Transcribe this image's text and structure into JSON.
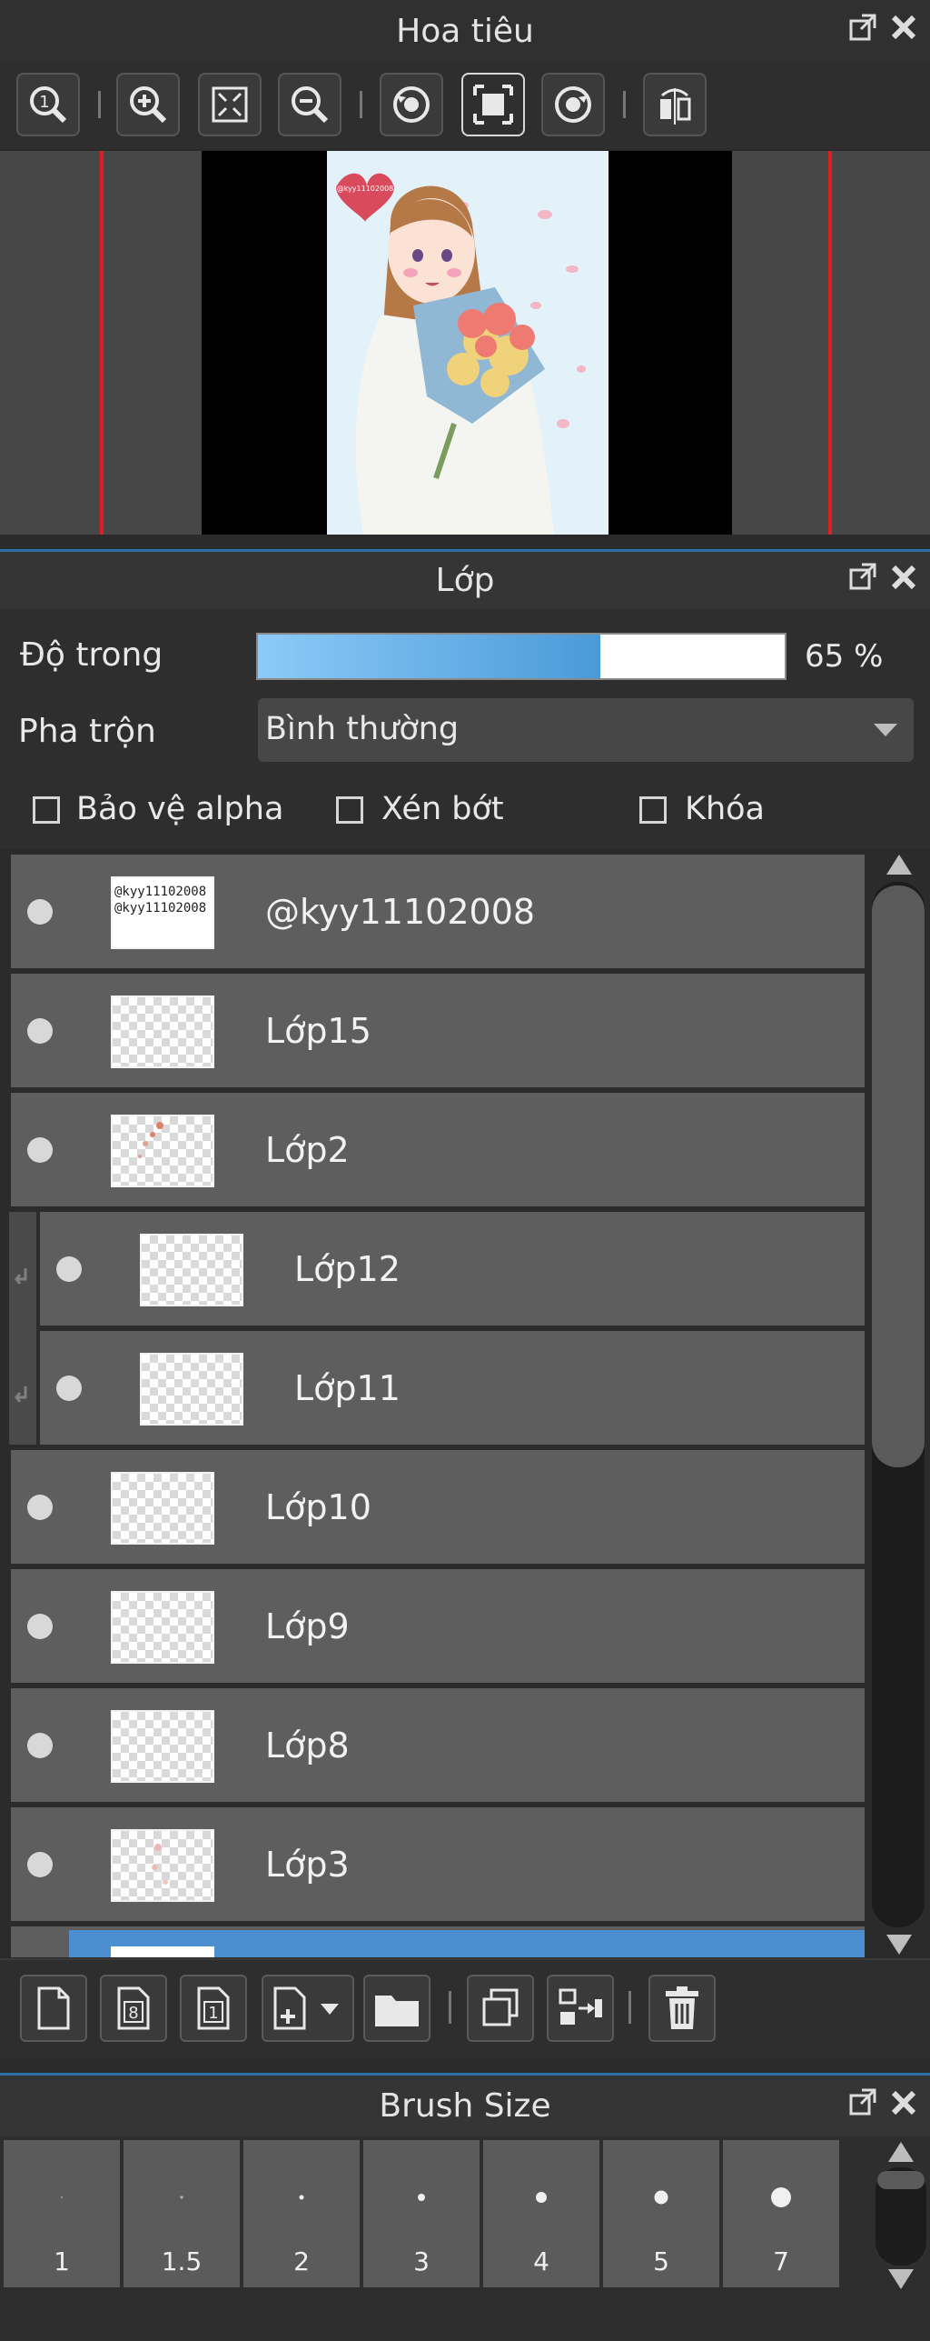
{
  "navigator": {
    "title": "Hoa tiêu",
    "tools": [
      "zoom-actual-icon",
      "zoom-in-icon",
      "fit-screen-icon",
      "zoom-out-icon",
      "rotate-left-icon",
      "fit-window-icon",
      "rotate-right-icon",
      "flip-horizontal-icon"
    ],
    "preview_badge": "@kyy11102008"
  },
  "layers": {
    "title": "Lớp",
    "opacity": {
      "label": "Độ trong",
      "value": 0.65,
      "value_text": "65 %"
    },
    "blend": {
      "label": "Pha trộn",
      "value": "Bình thường"
    },
    "checkboxes": [
      {
        "label": "Bảo vệ alpha",
        "checked": false
      },
      {
        "label": "Xén bớt",
        "checked": false
      },
      {
        "label": "Khóa",
        "checked": false
      }
    ],
    "items": [
      {
        "name": "@kyy11102008",
        "visible": true,
        "clipped": false,
        "thumb_text": "@kyy11102008 @kyy11102008"
      },
      {
        "name": "Lớp15",
        "visible": true,
        "clipped": false
      },
      {
        "name": "Lớp2",
        "visible": true,
        "clipped": false
      },
      {
        "name": "Lớp12",
        "visible": true,
        "clipped": true
      },
      {
        "name": "Lớp11",
        "visible": true,
        "clipped": true
      },
      {
        "name": "Lớp10",
        "visible": true,
        "clipped": false
      },
      {
        "name": "Lớp9",
        "visible": true,
        "clipped": false
      },
      {
        "name": "Lớp8",
        "visible": true,
        "clipped": false
      },
      {
        "name": "Lớp3",
        "visible": true,
        "clipped": false
      }
    ],
    "bottom_tools": [
      "new-layer-icon",
      "new-8bit-layer-icon",
      "new-1bit-layer-icon",
      "add-layer-menu-icon",
      "new-folder-icon",
      "duplicate-layer-icon",
      "merge-down-icon",
      "delete-layer-icon"
    ]
  },
  "brush_size": {
    "title": "Brush Size",
    "sizes": [
      "1",
      "1.5",
      "2",
      "3",
      "4",
      "5",
      "7"
    ]
  },
  "colors": {
    "accent": "#2e6fa6",
    "slider_fill": "#5aaee8",
    "selected_row": "#4c8fd0"
  }
}
